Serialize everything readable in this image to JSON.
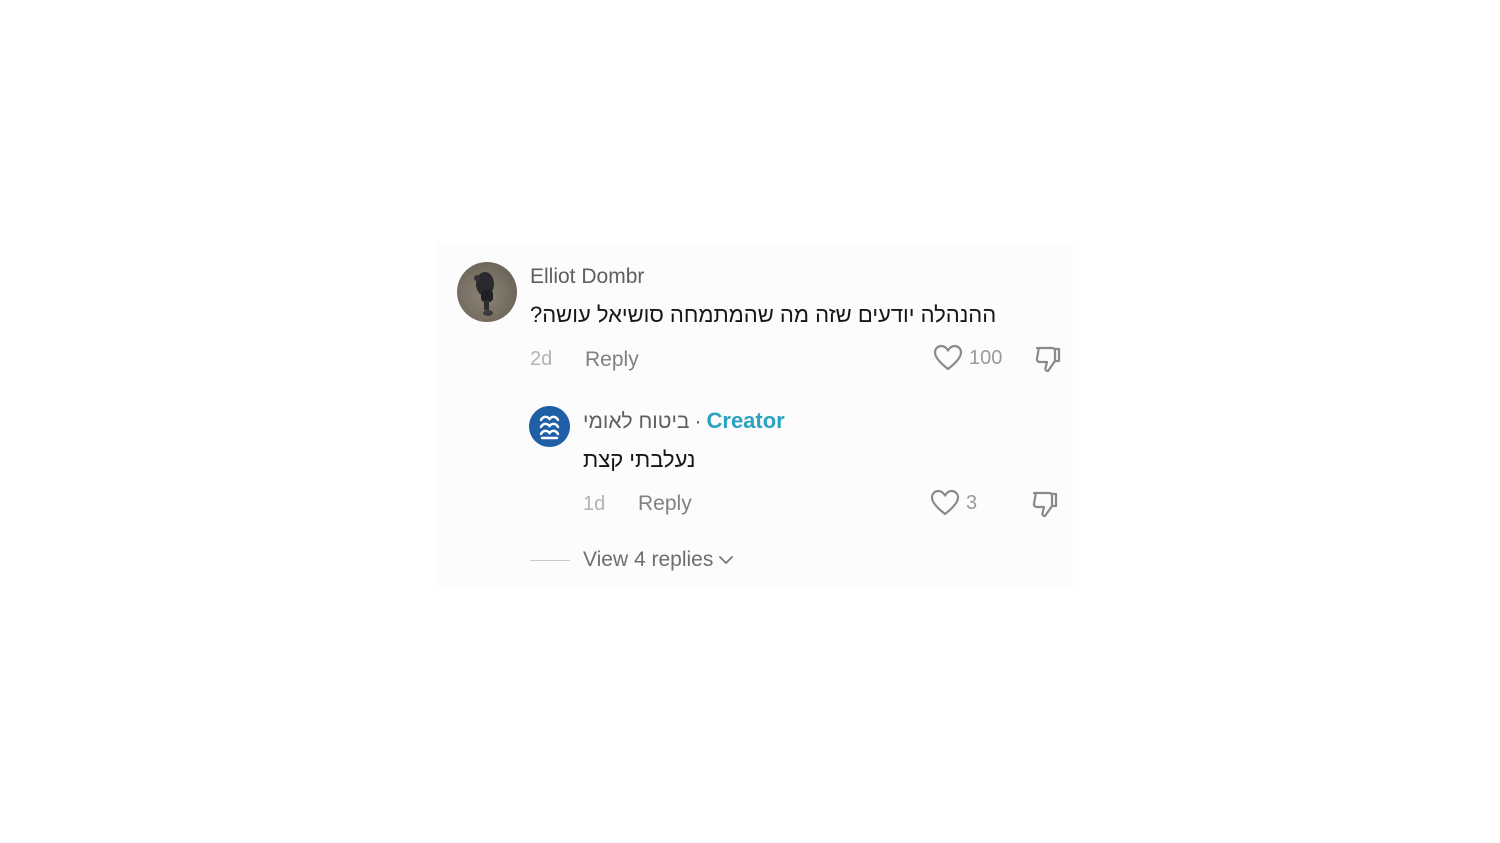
{
  "comment": {
    "author": "Elliot Dombr",
    "text": "ההנהלה יודעים שזה מה שהמתמחה סושיאל עושה?",
    "time": "2d",
    "reply_label": "Reply",
    "likes": "100",
    "icons": {
      "like": "heart-outline-icon",
      "dislike": "thumbs-down-icon"
    }
  },
  "reply": {
    "author": "ביטוח לאומי",
    "separator": "·",
    "badge": "Creator",
    "text": "נעלבתי קצת",
    "time": "1d",
    "reply_label": "Reply",
    "likes": "3",
    "avatar_icon": "national-insurance-logo-icon"
  },
  "view_replies": {
    "label": "View 4 replies",
    "icon": "chevron-down-icon"
  },
  "colors": {
    "creator_accent": "#29a3bf",
    "avatar_brand": "#1f5fa6",
    "muted_text": "#808080",
    "body_text": "#161616"
  }
}
